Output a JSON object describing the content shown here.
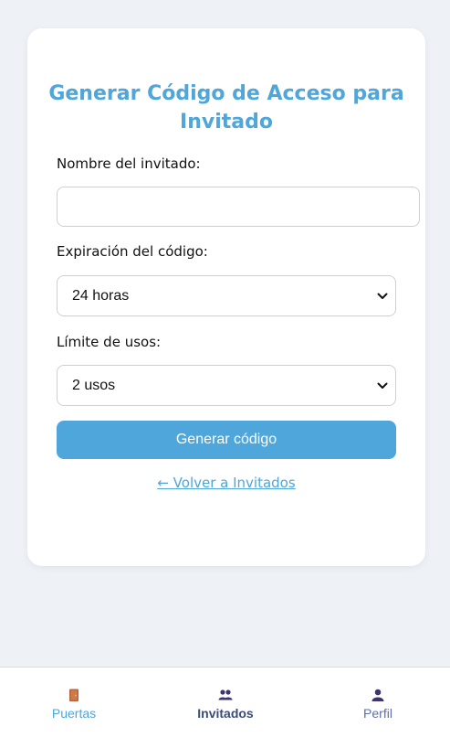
{
  "form": {
    "title": "Generar Código de Acceso para Invitado",
    "name_label": "Nombre del invitado:",
    "name_value": "",
    "expiration_label": "Expiración del código:",
    "expiration_value": "24 horas",
    "usage_label": "Límite de usos:",
    "usage_value": "2 usos",
    "submit_label": "Generar código",
    "back_link": "← Volver a Invitados"
  },
  "nav": {
    "items": [
      {
        "label": "Puertas",
        "icon": "door-icon",
        "color": "#4ea6da",
        "active": false
      },
      {
        "label": "Invitados",
        "icon": "people-icon",
        "color": "#3a4c7a",
        "active": true
      },
      {
        "label": "Perfil",
        "icon": "user-icon",
        "color": "#5f6fa8",
        "active": false
      }
    ]
  },
  "colors": {
    "accent": "#4ea6da",
    "background": "#eef2f7",
    "card": "#ffffff"
  }
}
